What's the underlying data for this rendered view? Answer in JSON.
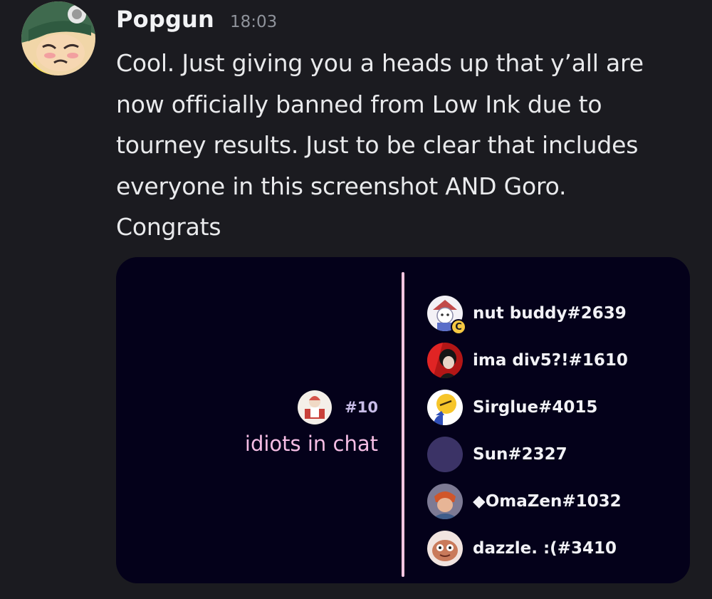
{
  "message": {
    "author": "Popgun",
    "timestamp": "18:03",
    "lines": [
      "Cool. Just giving you a heads up that y’all are",
      "now officially banned from Low Ink due to",
      "tourney results. Just to be clear that includes",
      "everyone in this screenshot AND Goro.",
      "Congrats"
    ]
  },
  "embed": {
    "team": {
      "seed": "#10",
      "name": "idiots in chat"
    },
    "players": [
      {
        "name": "nut buddy#2639",
        "captain_badge": "C"
      },
      {
        "name": "ima div5?!#1610"
      },
      {
        "name": "Sirglue#4015"
      },
      {
        "name": "Sun#2327"
      },
      {
        "name": "◆OmaZen#1032"
      },
      {
        "name": "dazzle. :(#3410"
      }
    ]
  },
  "colors": {
    "background": "#1b1b20",
    "embed_background": "#04011a",
    "team_name": "#f5bde4",
    "divider": "#f7c6e0",
    "captain_badge": "#f5c842"
  }
}
